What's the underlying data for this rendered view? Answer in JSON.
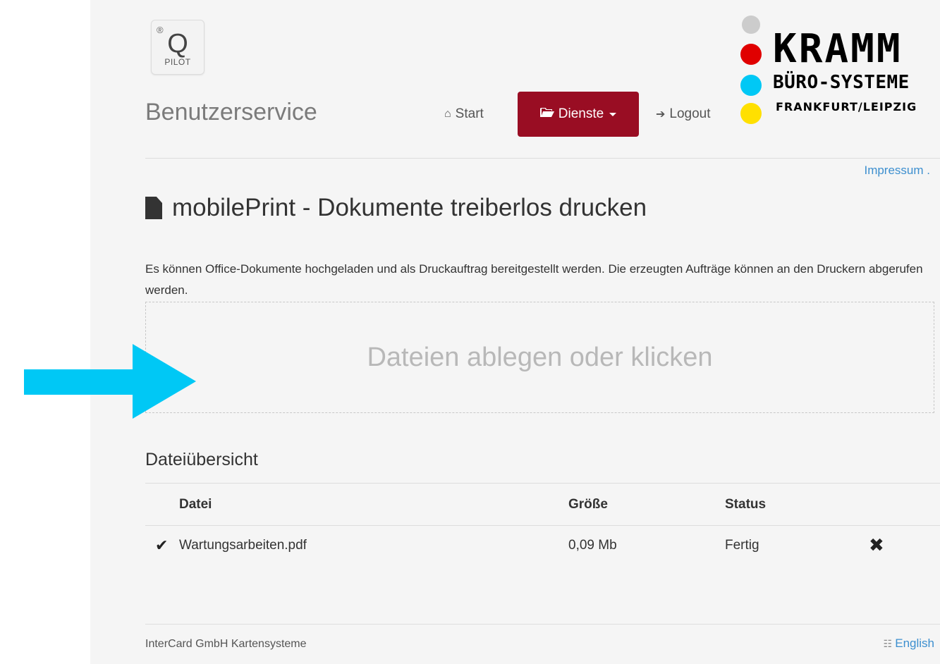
{
  "header": {
    "app_logo_text": "Q",
    "app_logo_sub": "PILOT",
    "app_logo_reg": "®",
    "brand_title": "Benutzerservice"
  },
  "nav": {
    "start": "Start",
    "dienste": "Dienste",
    "logout": "Logout",
    "active_color": "#990d23"
  },
  "partner_logo": {
    "line1": "KRAMM",
    "line2": "BÜRO-SYSTEME",
    "line3": "FRANKFURT/LEIPZIG",
    "dot_colors": [
      "#cccccc",
      "#e00000",
      "#00c8f5",
      "#ffe000"
    ]
  },
  "links": {
    "impressum": "Impressum ."
  },
  "main": {
    "title": "mobilePrint - Dokumente treiberlos drucken",
    "description": "Es können Office-Dokumente hochgeladen und als Druckauftrag bereitgestellt werden. Die erzeugten Aufträge können an den Druckern abgerufen werden.",
    "dropzone_label": "Dateien ablegen oder klicken"
  },
  "file_overview": {
    "title": "Dateiübersicht",
    "columns": [
      "Datei",
      "Größe",
      "Status"
    ],
    "rows": [
      {
        "name": "Wartungsarbeiten.pdf",
        "size": "0,09 Mb",
        "status": "Fertig"
      }
    ]
  },
  "footer": {
    "company": "InterCard GmbH Kartensysteme",
    "language": "English"
  },
  "annotation": {
    "arrow_color": "#00c8f5"
  }
}
